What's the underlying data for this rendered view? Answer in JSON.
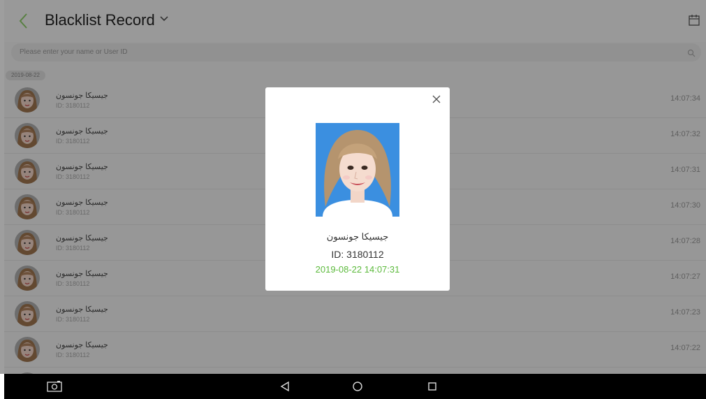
{
  "header": {
    "title": "Blacklist Record"
  },
  "search": {
    "placeholder": "Please enter your name or User ID"
  },
  "date_group": "2019-08-22",
  "records": [
    {
      "name": "جيسيكا جونسون",
      "id": "ID: 3180112",
      "time": "14:07:34"
    },
    {
      "name": "جيسيكا جونسون",
      "id": "ID: 3180112",
      "time": "14:07:32"
    },
    {
      "name": "جيسيكا جونسون",
      "id": "ID: 3180112",
      "time": "14:07:31"
    },
    {
      "name": "جيسيكا جونسون",
      "id": "ID: 3180112",
      "time": "14:07:30"
    },
    {
      "name": "جيسيكا جونسون",
      "id": "ID: 3180112",
      "time": "14:07:28"
    },
    {
      "name": "جيسيكا جونسون",
      "id": "ID: 3180112",
      "time": "14:07:27"
    },
    {
      "name": "جيسيكا جونسون",
      "id": "ID: 3180112",
      "time": "14:07:23"
    },
    {
      "name": "جيسيكا جونسون",
      "id": "ID: 3180112",
      "time": "14:07:22"
    }
  ],
  "dialog": {
    "name": "جيسيكا جونسون",
    "id": "ID: 3180112",
    "datetime": "2019-08-22 14:07:31"
  },
  "colors": {
    "accent_green": "#5cba3c",
    "photo_bg": "#3b8fe0"
  },
  "icons": {
    "back": "chevron-left-icon",
    "title_dropdown": "chevron-down-icon",
    "calendar": "calendar-icon",
    "search": "search-icon",
    "close": "close-icon",
    "nav": [
      "screenshot-icon",
      "back-triangle-icon",
      "home-circle-icon",
      "recents-square-icon"
    ]
  }
}
